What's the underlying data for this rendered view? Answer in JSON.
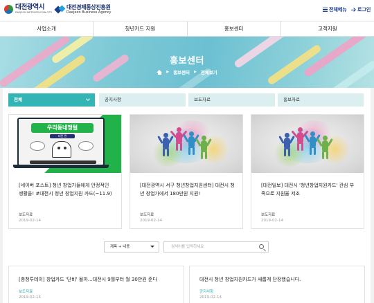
{
  "header": {
    "logo1": {
      "name": "대전광역시",
      "sub": "DAEJEON METROPOLITAN CITY"
    },
    "logo2": {
      "name": "대전경제통상진흥원",
      "sub": "Daejeon Business Agency"
    },
    "all_menu_label": "전체메뉴",
    "login_label": "로그인"
  },
  "nav": {
    "items": [
      {
        "label": "사업소개"
      },
      {
        "label": "청년카드 지원"
      },
      {
        "label": "홍보센터"
      },
      {
        "label": "고객지원"
      }
    ]
  },
  "hero": {
    "title": "홍보센터",
    "breadcrumb": [
      "홍보센터",
      "전체보기"
    ]
  },
  "tabs": [
    {
      "label": "전체",
      "active": true
    },
    {
      "label": "공지사항",
      "active": false
    },
    {
      "label": "보도자료",
      "active": false
    },
    {
      "label": "홍보자료",
      "active": false
    }
  ],
  "cards": [
    {
      "title": "[네이버 포스트] 청년 창업가들에게 안정적인 생활을! #대전시 청년 창업지원 카드(~11.9)",
      "category": "보도자료",
      "date": "2019-02-14",
      "thumb": {
        "headline": "우리동네맹털",
        "subline": "대전 편"
      }
    },
    {
      "title": "[대전광역시 서구 청년창업지원센터] 대전시 청년 창업가에서 180만원 지원!",
      "category": "보도자료",
      "date": "2019-02-14"
    },
    {
      "title": "[대전일보] 대전시 '청년창업지원카드' 관심 부족으로 지원율 저조",
      "category": "보도자료",
      "date": "2019-02-14"
    }
  ],
  "search": {
    "select_value": "제목 + 내용",
    "placeholder": "검색어를 입력하세요"
  },
  "list": [
    {
      "title": "[충청투데이] 창업카드 '단비' 될까…대전시 9월부터 월 30만원 준다",
      "category": "보도자료",
      "date": "2019-02-14"
    },
    {
      "title": "대전시 청년 창업지원카드가 새롭게 단장했습니다.",
      "category": "공지사항",
      "date": "2019-02-14"
    }
  ],
  "colors": {
    "accent": "#33b5b6",
    "tab_bg": "#dbeff1",
    "brand_navy": "#1a3f8f",
    "green": "#21b34a"
  }
}
